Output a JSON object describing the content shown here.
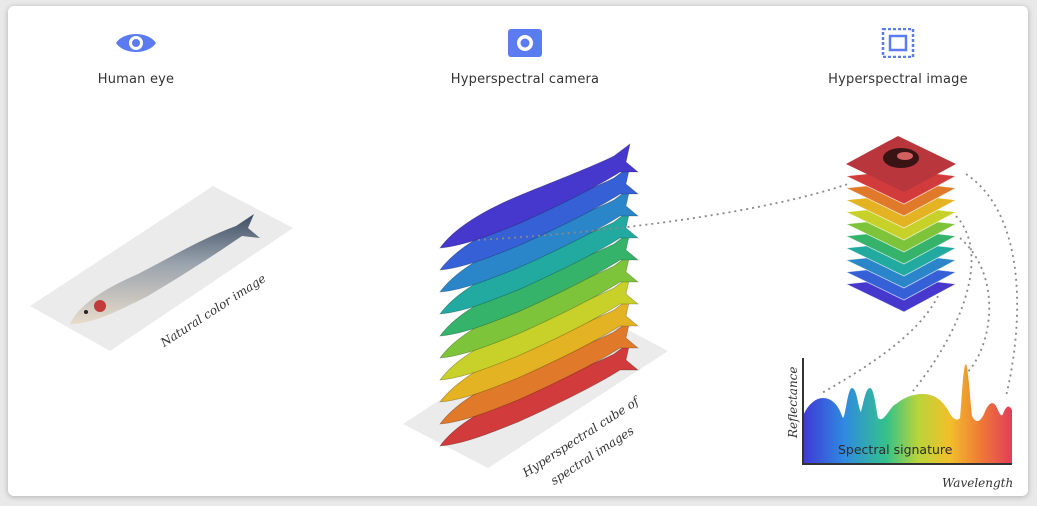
{
  "columns": [
    {
      "label": "Human eye",
      "icon": "eye-icon"
    },
    {
      "label": "Hyperspectral camera",
      "icon": "camera-icon"
    },
    {
      "label": "Hyperspectral image",
      "icon": "image-frame-icon"
    }
  ],
  "annotations": {
    "natural": "Natural color image",
    "cube_line1": "Hyperspectral cube of",
    "cube_line2": "spectral images"
  },
  "plot": {
    "ylabel": "Reflectance",
    "xlabel": "Wavelength",
    "center_label": "Spectral signature"
  },
  "colors": {
    "accent": "#5b7bf0",
    "slab_colors": [
      "#d23b3b",
      "#e07a2a",
      "#e4b323",
      "#c8d12a",
      "#7ec43a",
      "#35b36b",
      "#22a9a0",
      "#2a86c8",
      "#3560d6",
      "#4638cc"
    ]
  }
}
